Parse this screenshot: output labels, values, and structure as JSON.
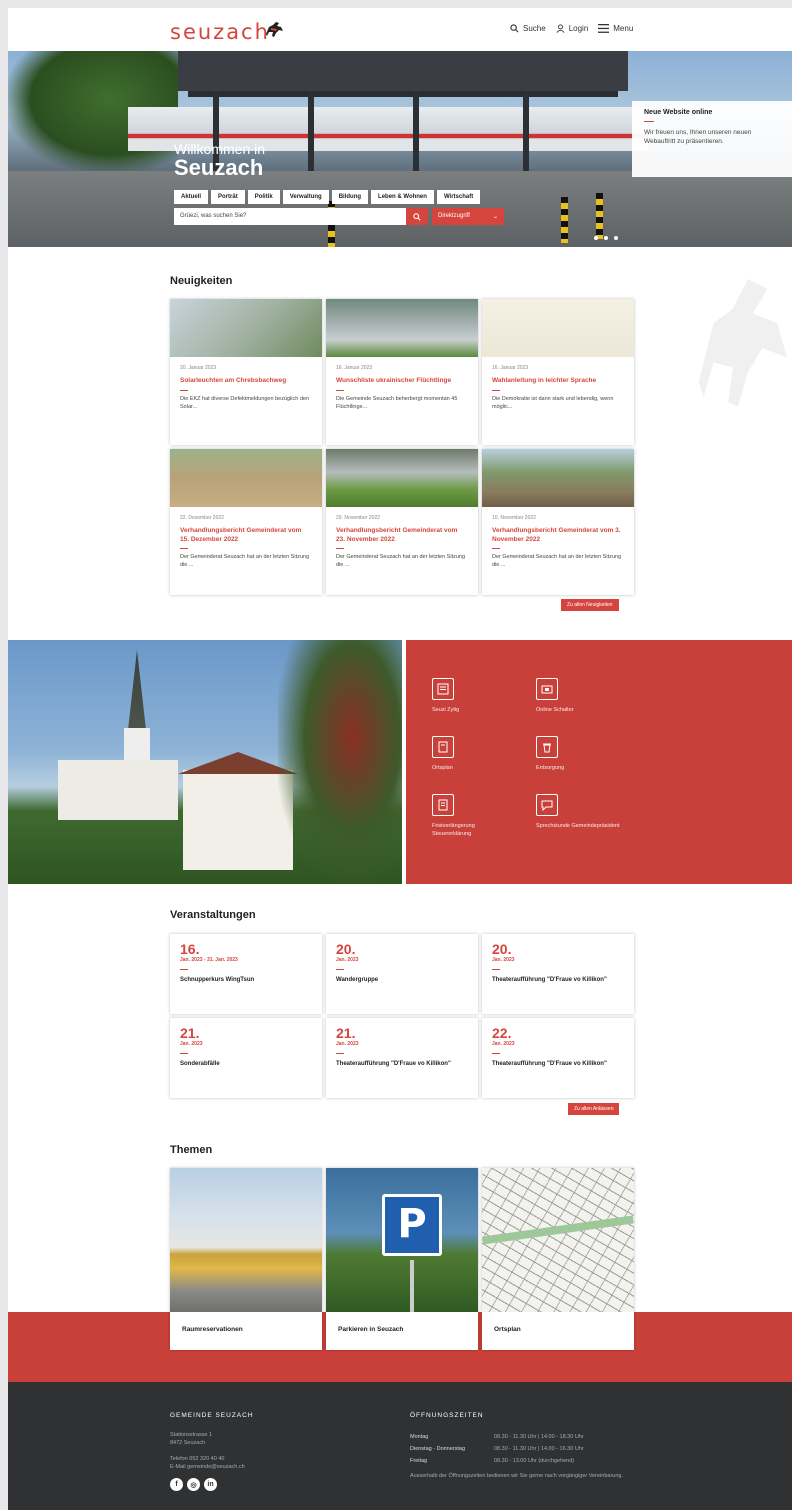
{
  "header": {
    "logo": "seuzach",
    "nav": {
      "search": "Suche",
      "login": "Login",
      "menu": "Menu"
    }
  },
  "hero": {
    "welcome": "Willkommen in",
    "title": "Seuzach",
    "tabs": [
      "Aktuell",
      "Porträt",
      "Politik",
      "Verwaltung",
      "Bildung",
      "Leben & Wohnen",
      "Wirtschaft"
    ],
    "search_placeholder": "Grüezi, was suchen Sie?",
    "quick_button": "Direktzugriff",
    "news_box": {
      "title": "Neue Website online",
      "text": "Wir freuen uns, Ihnen unseren neuen Webauftritt zu präsentieren."
    }
  },
  "news": {
    "title": "Neuigkeiten",
    "items": [
      {
        "date": "20. Januar 2023",
        "title": "Solarleuchten am Chrebsbachweg",
        "text": "Die EKZ hat diverse Defektmeldungen bezüglich den Solar..."
      },
      {
        "date": "16. Januar 2023",
        "title": "Wunschliste ukrainischer Flüchtlinge",
        "text": "Die Gemeinde Seuzach beherbergt momentan 45 Flüchtlinge..."
      },
      {
        "date": "16. Januar 2023",
        "title": "Wahlanleitung in leichter Sprache",
        "text": "Die Demokratie ist dann stark und lebendig, wenn möglic..."
      },
      {
        "date": "22. Dezember 2022",
        "title": "Verhandlungsbericht Gemeinderat vom 15. Dezember 2022",
        "text": "Der Gemeinderat Seuzach hat an der letzten Sitzung die ..."
      },
      {
        "date": "29. November 2022",
        "title": "Verhandlungsbericht Gemeinderat vom 23. November 2022",
        "text": "Der Gemeinderat Seuzach hat an der letzten Sitzung die ..."
      },
      {
        "date": "10. November 2022",
        "title": "Verhandlungsbericht Gemeinderat vom 3. November 2022",
        "text": "Der Gemeinderat Seuzach hat an der letzten Sitzung die ..."
      }
    ],
    "all_button": "Zu allen Neuigkeiten"
  },
  "services": [
    {
      "label": "Seuzi Zytig",
      "icon": "newspaper-icon"
    },
    {
      "label": "Online Schalter",
      "icon": "counter-icon"
    },
    {
      "label": "Ortsplan",
      "icon": "map-document-icon"
    },
    {
      "label": "Entsorgung",
      "icon": "recycling-icon"
    },
    {
      "label": "Fristverlängerung Steuererklärung",
      "icon": "tax-document-icon"
    },
    {
      "label": "Sprechstunde Gemeindepräsident",
      "icon": "chat-icon"
    }
  ],
  "events": {
    "title": "Veranstaltungen",
    "items": [
      {
        "day": "16.",
        "month": "Jan. 2023 - 31. Jan. 2023",
        "title": "Schnupperkurs WingTsun"
      },
      {
        "day": "20.",
        "month": "Jan. 2023",
        "title": "Wandergruppe"
      },
      {
        "day": "20.",
        "month": "Jan. 2023",
        "title": "Theateraufführung \"D'Fraue vo Killikon\""
      },
      {
        "day": "21.",
        "month": "Jan. 2023",
        "title": "Sonderabfälle"
      },
      {
        "day": "21.",
        "month": "Jan. 2023",
        "title": "Theateraufführung \"D'Fraue vo Killikon\""
      },
      {
        "day": "22.",
        "month": "Jan. 2023",
        "title": "Theateraufführung \"D'Fraue vo Killikon\""
      }
    ],
    "all_button": "Zu allen Anlässen"
  },
  "themes": {
    "title": "Themen",
    "items": [
      {
        "label": "Raumreservationen"
      },
      {
        "label": "Parkieren in Seuzach"
      },
      {
        "label": "Ortsplan"
      }
    ]
  },
  "footer": {
    "org_title": "GEMEINDE SEUZACH",
    "address1": "Stationsstrasse 1",
    "address2": "8472 Seuzach",
    "phone": "Telefon   052 320 40 40",
    "email": "E-Mail   gemeinde@seuzach.ch",
    "hours_title": "ÖFFNUNGSZEITEN",
    "hours": [
      {
        "day": "Montag",
        "time": "08.30 - 11.30 Uhr | 14.00 - 18.30 Uhr"
      },
      {
        "day": "Dienstag - Donnerstag",
        "time": "08.30 - 11.30 Uhr | 14.00 - 16.30 Uhr"
      },
      {
        "day": "Freitag",
        "time": "08.30 - 13.00 Uhr (durchgehend)"
      }
    ],
    "hours_note": "Ausserhalb der Öffnungszeiten bedienen wir Sie gerne nach vorgängiger Vereinbarung.",
    "social": [
      "f",
      "◎",
      "in"
    ]
  },
  "colors": {
    "brand_red": "#d6453d",
    "footer_bg": "#2f3133"
  }
}
